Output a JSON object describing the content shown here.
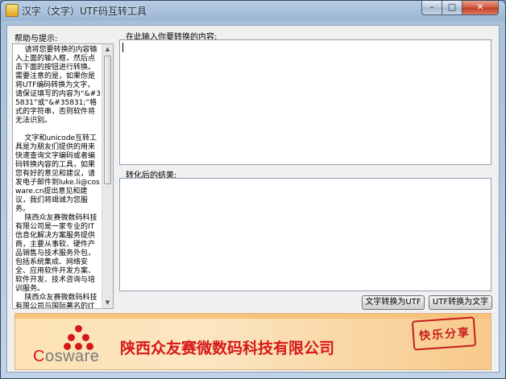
{
  "window": {
    "title": "汉字（文字）UTF码互转工具",
    "controls": {
      "minimize": "–",
      "maximize": "□",
      "close": "✕"
    }
  },
  "help": {
    "title": "帮助与提示:",
    "text": "    请将您要转换的内容输入上面的输入框，然后点击下面的按钮进行转换。需要注意的是，如果你是将UTF编码转换为文字，请保证填写的内容为“&#35831”或“&#35831;”格式的字符串，否则软件将无法识别。\n\n    文字和unicode互转工具是为朋友们提供的用来快速查询文字编码或者编码转换内容的工具，如果您有好的意见和建议，请发电子邮件到luke.li@cosware.cn提出意见和建议，我们将竭诚为您服务。\n    陕西众友赛微数码科技有限公司是一家专业的IT信息化解决方案服务提供商，主要从事软、硬件产品销售与技术服务外包，包括系统集成、网络安全、应用软件开发方案、软件开发、技术咨询与培训服务。\n    陕西众友赛微数码科技有限公司与国际著名的IT厂商保持着长期紧密的战略合作伙伴关系，是微软（Microsoft）的金牌认证合作伙伴：.NET开发和"
  },
  "input": {
    "label": "在此输入你要转换的内容:",
    "value": ""
  },
  "output": {
    "label": "转化后的结果:",
    "value": ""
  },
  "buttons": {
    "to_utf": "文字转换为UTF",
    "to_text": "UTF转换为文字"
  },
  "banner": {
    "logo_text_prefix": "C",
    "logo_text_rest": "osware",
    "company_name": "陕西众友赛微数码科技有限公司",
    "seal_text": "快乐分享"
  },
  "colors": {
    "brand_red": "#d71818",
    "banner_bg": "#fbe6c1",
    "close_red": "#c13a1f"
  },
  "icons": {
    "app": "app-icon",
    "minimize": "minimize-icon",
    "maximize": "maximize-icon",
    "close": "close-icon",
    "scroll_up": "triangle-up-icon",
    "scroll_down": "triangle-down-icon"
  }
}
